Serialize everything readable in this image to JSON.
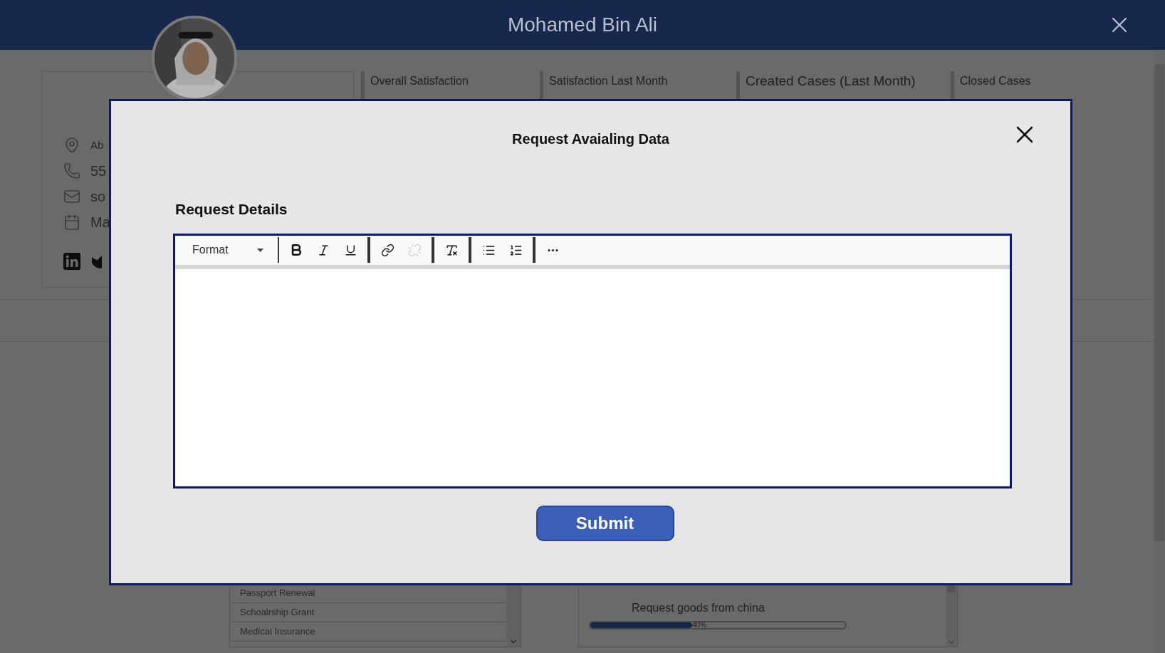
{
  "header": {
    "title": "Mohamed Bin Ali"
  },
  "profile": {
    "details": [
      {
        "kind": "location",
        "text": "Ab"
      },
      {
        "kind": "phone",
        "text": "55"
      },
      {
        "kind": "email",
        "text": "so"
      },
      {
        "kind": "calendar",
        "text": "Ma"
      }
    ]
  },
  "stats": [
    {
      "label": "Overall Satisfaction",
      "large": false
    },
    {
      "label": "Satisfaction Last Month",
      "large": false
    },
    {
      "label": "Created Cases (Last Month)",
      "large": true
    },
    {
      "label": "Closed Cases",
      "large": false
    }
  ],
  "services": {
    "items": [
      "Passport Renewal",
      "Schoalrship Grant",
      "Medical Insurance"
    ]
  },
  "requests": [
    {
      "title": "Request goods from china",
      "level": 0.4,
      "reading": "40%"
    }
  ],
  "dialog": {
    "title": "Request Avaialing Data",
    "section_label": "Request Details",
    "editor": {
      "format_label": "Format",
      "tool_groups": [
        [
          {
            "kind": "bold",
            "disabled": false
          },
          {
            "kind": "italic",
            "disabled": false
          },
          {
            "kind": "underline",
            "disabled": false
          }
        ],
        [
          {
            "kind": "link",
            "disabled": false
          },
          {
            "kind": "unlink",
            "disabled": true
          }
        ],
        [
          {
            "kind": "clear-format",
            "disabled": false
          }
        ],
        [
          {
            "kind": "bullet-list",
            "disabled": false
          },
          {
            "kind": "numbered-list",
            "disabled": false
          }
        ],
        [
          {
            "kind": "more",
            "disabled": false
          }
        ]
      ]
    },
    "submit": "Submit"
  }
}
